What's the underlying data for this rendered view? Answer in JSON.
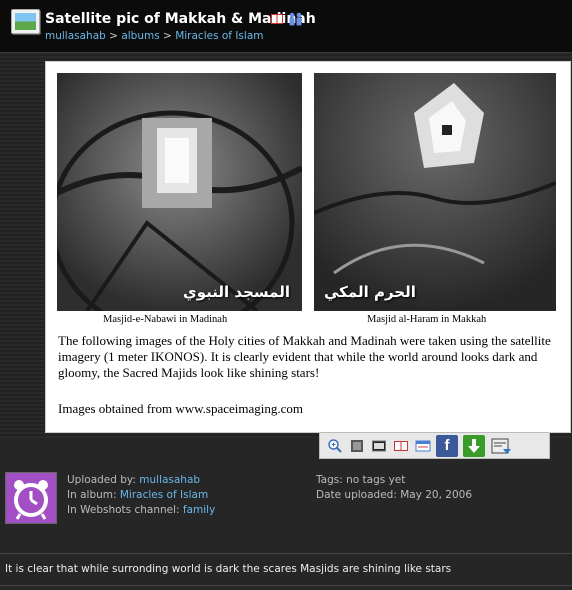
{
  "header": {
    "title": "Satellite pic of Makkah & Madinah",
    "breadcrumb": {
      "user": "mullasahab",
      "sep1": ">",
      "albums": "albums",
      "sep2": ">",
      "album": "Miracles of Islam"
    }
  },
  "photo": {
    "left_arabic": "المسجد النبوي",
    "right_arabic": "الحرم المكي",
    "left_caption": "Masjid-e-Nabawi in Madinah",
    "right_caption": "Masjid al-Haram in Makkah",
    "description": "The following images of the Holy cities of Makkah and Madinah were taken using the satellite imagery (1 meter IKONOS).  It is clearly evident that while the world around looks dark and gloomy, the Sacred Majids look like shining stars!",
    "source": "Images obtained from www.spaceimaging.com"
  },
  "toolbar": {
    "icons": [
      "zoom-in-icon",
      "slideshow-icon",
      "screen-icon",
      "book-icon",
      "card-icon",
      "facebook-icon",
      "download-icon",
      "share-icon"
    ],
    "facebook_label": "f",
    "accent_facebook": "#3b5998",
    "accent_download": "#3a9a2a"
  },
  "meta": {
    "uploaded_by_label": "Uploaded by:",
    "uploaded_by": "mullasahab",
    "in_album_label": "In album:",
    "in_album": "Miracles of Islam",
    "channel_label": "In Webshots channel:",
    "channel": "family",
    "tags_label": "Tags:",
    "tags": "no tags yet",
    "date_label": "Date uploaded:",
    "date": "May 20, 2006"
  },
  "comment": "It is clear that while surronding world is dark the scares Masjids are shining like stars"
}
